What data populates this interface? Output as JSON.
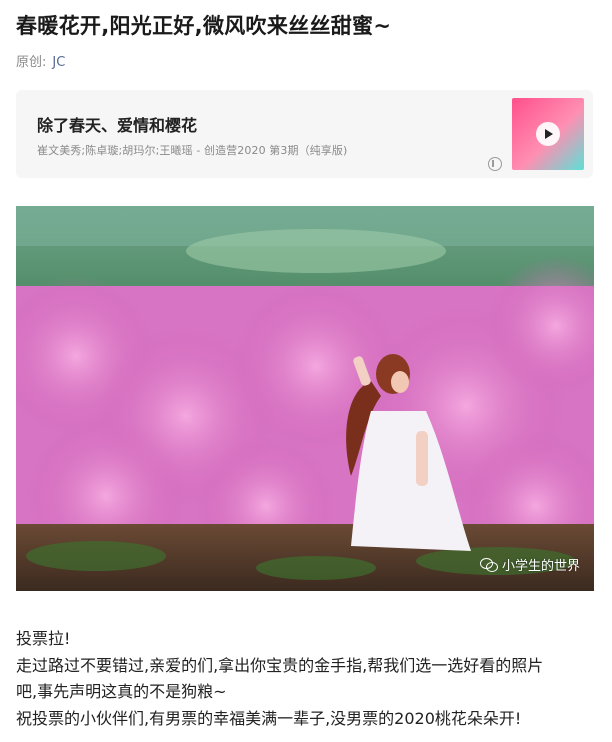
{
  "article": {
    "title": "春暖花开,阳光正好,微风吹来丝丝甜蜜~",
    "original_label": "原创:",
    "author": "JC"
  },
  "music": {
    "song": "除了春天、爱情和樱花",
    "singer": "崔文美秀;陈卓璇;胡玛尔;王曦瑶 - 创造营2020 第3期（纯享版)",
    "cover_icon": "play-icon"
  },
  "photo": {
    "watermark": "小学生的世界",
    "watermark_icon": "wechat-icon"
  },
  "body": {
    "lines": [
      "投票拉!",
      "走过路过不要错过,亲爱的们,拿出你宝贵的金手指,帮我们选一选好看的照片",
      "吧,事先声明这真的不是狗粮~",
      "祝投票的小伙伴们,有男票的幸福美满一辈子,没男票的2020桃花朵朵开!"
    ]
  }
}
